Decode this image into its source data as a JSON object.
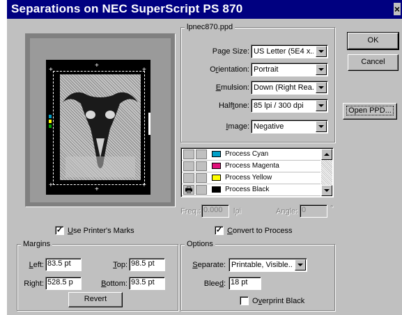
{
  "window": {
    "title": "Separations on NEC SuperScript PS 870",
    "close_glyph": "×"
  },
  "buttons": {
    "ok": "OK",
    "cancel": "Cancel",
    "open_ppd": "Open PPD...",
    "revert": "Revert"
  },
  "ppd_group": {
    "title": "lpnec870.ppd",
    "page_size": {
      "label_pre": "Page Size:",
      "value": "US Letter (5E4 x..."
    },
    "orientation": {
      "label_pre": "O",
      "label_u": "r",
      "label_post": "ientation:",
      "value": "Portrait"
    },
    "emulsion": {
      "label_u": "E",
      "label_post": "mulsion:",
      "value": "Down (Right Rea..."
    },
    "halftone": {
      "label_pre": "Half",
      "label_u": "t",
      "label_post": "one:",
      "value": "85 lpi / 300 dpi"
    },
    "image": {
      "label_u": "I",
      "label_post": "mage:",
      "value": "Negative"
    }
  },
  "inks": [
    {
      "name": "Process Cyan",
      "color": "#00a0c8",
      "printer_icon": ""
    },
    {
      "name": "Process Magenta",
      "color": "#e0107a",
      "printer_icon": ""
    },
    {
      "name": "Process Yellow",
      "color": "#ffff00",
      "printer_icon": ""
    },
    {
      "name": "Process Black",
      "color": "#000000",
      "printer_icon": "🖶"
    }
  ],
  "freq_angle": {
    "freq_label": "Freq.:",
    "freq_value": "0.000",
    "freq_unit": "lpi",
    "angle_label": "Angle:",
    "angle_value": "0",
    "angle_unit": "°"
  },
  "checkboxes": {
    "printers_marks": {
      "label_u": "U",
      "label_post": "se Printer's Marks",
      "checked": "✓"
    },
    "convert_process": {
      "label_u": "C",
      "label_post": "onvert to Process",
      "checked": "✓"
    },
    "overprint_black": {
      "label_pre": "O",
      "label_u": "v",
      "label_post": "erprint Black",
      "checked": ""
    }
  },
  "margins": {
    "title": "Margins",
    "left": {
      "label_u": "L",
      "label_post": "eft:",
      "value": "83.5 pt"
    },
    "top": {
      "label_u": "T",
      "label_post": "op:",
      "value": "98.5 pt"
    },
    "right": {
      "label_pre": "Ri",
      "label_u": "g",
      "label_post": "ht:",
      "value": "528.5 p"
    },
    "bottom": {
      "label_u": "B",
      "label_post": "ottom:",
      "value": "93.5 pt"
    }
  },
  "options": {
    "title": "Options",
    "separate": {
      "label_u": "S",
      "label_post": "eparate:",
      "value": "Printable, Visible..."
    },
    "bleed": {
      "label_pre": "Blee",
      "label_u": "d",
      "label_post": ":",
      "value": "18 pt"
    }
  }
}
